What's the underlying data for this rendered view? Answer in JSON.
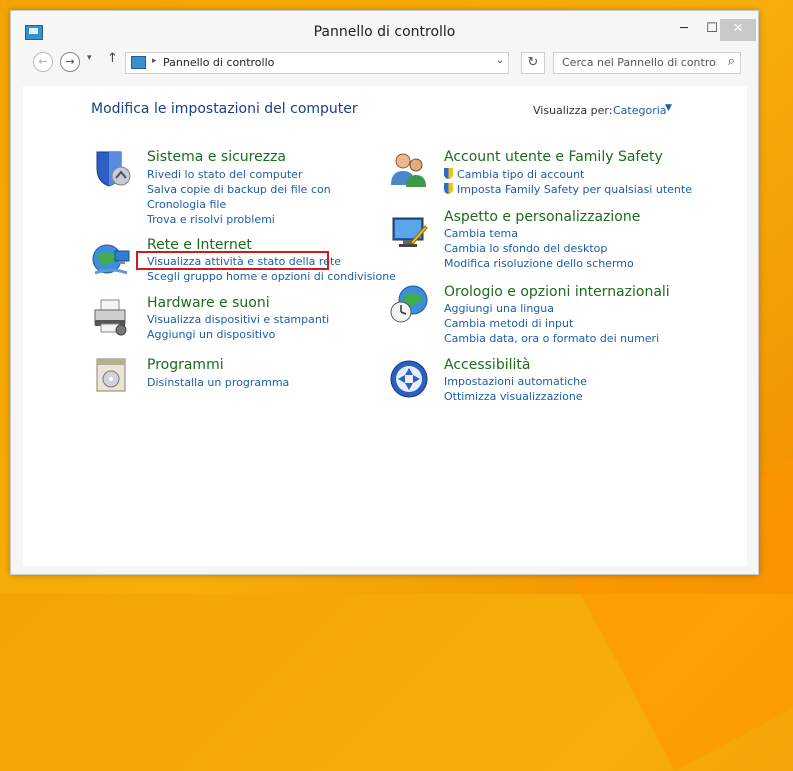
{
  "window": {
    "title": "Pannello di controllo",
    "controls": {
      "minimize": "─",
      "maximize": "☐",
      "close": "✕"
    }
  },
  "nav": {
    "back": "←",
    "forward": "→",
    "recent": "▾",
    "up": "↑",
    "address": "Pannello di controllo",
    "address_separator": "▸",
    "address_dropdown": "⌄",
    "refresh": "↻",
    "search_placeholder": "Cerca nel Pannello di controllo",
    "search_icon": "⌕"
  },
  "page": {
    "heading": "Modifica le impostazioni del computer",
    "view_by_label": "Visualizza per:",
    "view_by_value": "Categoria",
    "view_by_caret": "▼"
  },
  "left": [
    {
      "icon": "shield-icon",
      "title": "Sistema e sicurezza",
      "links": [
        "Rivedi lo stato del computer",
        "Salva copie di backup dei file con Cronologia file",
        "Trova e risolvi problemi"
      ]
    },
    {
      "icon": "network-globe-icon",
      "title": "Rete e Internet",
      "links": [
        "Visualizza attività e stato della rete",
        "Scegli gruppo home e opzioni di condivisione"
      ]
    },
    {
      "icon": "printer-icon",
      "title": "Hardware e suoni",
      "links": [
        "Visualizza dispositivi e stampanti",
        "Aggiungi un dispositivo"
      ]
    },
    {
      "icon": "programs-icon",
      "title": "Programmi",
      "links": [
        "Disinstalla un programma"
      ]
    }
  ],
  "right": [
    {
      "icon": "users-icon",
      "title": "Account utente e Family Safety",
      "links": [
        "Cambia tipo di account",
        "Imposta Family Safety per qualsiasi utente"
      ]
    },
    {
      "icon": "appearance-icon",
      "title": "Aspetto e personalizzazione",
      "links": [
        "Cambia tema",
        "Cambia lo sfondo del desktop",
        "Modifica risoluzione dello schermo"
      ]
    },
    {
      "icon": "clock-globe-icon",
      "title": "Orologio e opzioni internazionali",
      "links": [
        "Aggiungi una lingua",
        "Cambia metodi di input",
        "Cambia data, ora o formato dei numeri"
      ]
    },
    {
      "icon": "accessibility-icon",
      "title": "Accessibilità",
      "links": [
        "Impostazioni automatiche",
        "Ottimizza visualizzazione"
      ]
    }
  ]
}
